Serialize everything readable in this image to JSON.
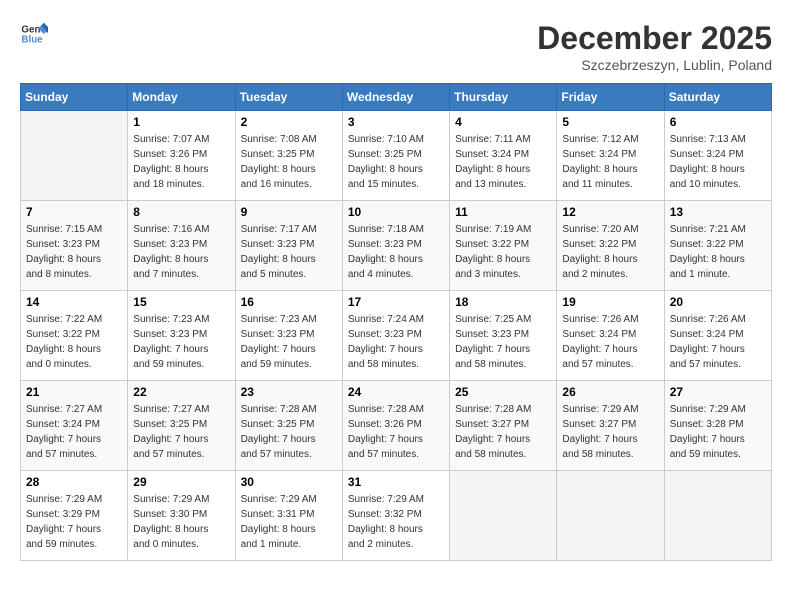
{
  "logo": {
    "text_general": "General",
    "text_blue": "Blue"
  },
  "title": "December 2025",
  "location": "Szczebrzeszyn, Lublin, Poland",
  "days_of_week": [
    "Sunday",
    "Monday",
    "Tuesday",
    "Wednesday",
    "Thursday",
    "Friday",
    "Saturday"
  ],
  "weeks": [
    [
      {
        "day": "",
        "info": ""
      },
      {
        "day": "1",
        "info": "Sunrise: 7:07 AM\nSunset: 3:26 PM\nDaylight: 8 hours\nand 18 minutes."
      },
      {
        "day": "2",
        "info": "Sunrise: 7:08 AM\nSunset: 3:25 PM\nDaylight: 8 hours\nand 16 minutes."
      },
      {
        "day": "3",
        "info": "Sunrise: 7:10 AM\nSunset: 3:25 PM\nDaylight: 8 hours\nand 15 minutes."
      },
      {
        "day": "4",
        "info": "Sunrise: 7:11 AM\nSunset: 3:24 PM\nDaylight: 8 hours\nand 13 minutes."
      },
      {
        "day": "5",
        "info": "Sunrise: 7:12 AM\nSunset: 3:24 PM\nDaylight: 8 hours\nand 11 minutes."
      },
      {
        "day": "6",
        "info": "Sunrise: 7:13 AM\nSunset: 3:24 PM\nDaylight: 8 hours\nand 10 minutes."
      }
    ],
    [
      {
        "day": "7",
        "info": "Sunrise: 7:15 AM\nSunset: 3:23 PM\nDaylight: 8 hours\nand 8 minutes."
      },
      {
        "day": "8",
        "info": "Sunrise: 7:16 AM\nSunset: 3:23 PM\nDaylight: 8 hours\nand 7 minutes."
      },
      {
        "day": "9",
        "info": "Sunrise: 7:17 AM\nSunset: 3:23 PM\nDaylight: 8 hours\nand 5 minutes."
      },
      {
        "day": "10",
        "info": "Sunrise: 7:18 AM\nSunset: 3:23 PM\nDaylight: 8 hours\nand 4 minutes."
      },
      {
        "day": "11",
        "info": "Sunrise: 7:19 AM\nSunset: 3:22 PM\nDaylight: 8 hours\nand 3 minutes."
      },
      {
        "day": "12",
        "info": "Sunrise: 7:20 AM\nSunset: 3:22 PM\nDaylight: 8 hours\nand 2 minutes."
      },
      {
        "day": "13",
        "info": "Sunrise: 7:21 AM\nSunset: 3:22 PM\nDaylight: 8 hours\nand 1 minute."
      }
    ],
    [
      {
        "day": "14",
        "info": "Sunrise: 7:22 AM\nSunset: 3:22 PM\nDaylight: 8 hours\nand 0 minutes."
      },
      {
        "day": "15",
        "info": "Sunrise: 7:23 AM\nSunset: 3:23 PM\nDaylight: 7 hours\nand 59 minutes."
      },
      {
        "day": "16",
        "info": "Sunrise: 7:23 AM\nSunset: 3:23 PM\nDaylight: 7 hours\nand 59 minutes."
      },
      {
        "day": "17",
        "info": "Sunrise: 7:24 AM\nSunset: 3:23 PM\nDaylight: 7 hours\nand 58 minutes."
      },
      {
        "day": "18",
        "info": "Sunrise: 7:25 AM\nSunset: 3:23 PM\nDaylight: 7 hours\nand 58 minutes."
      },
      {
        "day": "19",
        "info": "Sunrise: 7:26 AM\nSunset: 3:24 PM\nDaylight: 7 hours\nand 57 minutes."
      },
      {
        "day": "20",
        "info": "Sunrise: 7:26 AM\nSunset: 3:24 PM\nDaylight: 7 hours\nand 57 minutes."
      }
    ],
    [
      {
        "day": "21",
        "info": "Sunrise: 7:27 AM\nSunset: 3:24 PM\nDaylight: 7 hours\nand 57 minutes."
      },
      {
        "day": "22",
        "info": "Sunrise: 7:27 AM\nSunset: 3:25 PM\nDaylight: 7 hours\nand 57 minutes."
      },
      {
        "day": "23",
        "info": "Sunrise: 7:28 AM\nSunset: 3:25 PM\nDaylight: 7 hours\nand 57 minutes."
      },
      {
        "day": "24",
        "info": "Sunrise: 7:28 AM\nSunset: 3:26 PM\nDaylight: 7 hours\nand 57 minutes."
      },
      {
        "day": "25",
        "info": "Sunrise: 7:28 AM\nSunset: 3:27 PM\nDaylight: 7 hours\nand 58 minutes."
      },
      {
        "day": "26",
        "info": "Sunrise: 7:29 AM\nSunset: 3:27 PM\nDaylight: 7 hours\nand 58 minutes."
      },
      {
        "day": "27",
        "info": "Sunrise: 7:29 AM\nSunset: 3:28 PM\nDaylight: 7 hours\nand 59 minutes."
      }
    ],
    [
      {
        "day": "28",
        "info": "Sunrise: 7:29 AM\nSunset: 3:29 PM\nDaylight: 7 hours\nand 59 minutes."
      },
      {
        "day": "29",
        "info": "Sunrise: 7:29 AM\nSunset: 3:30 PM\nDaylight: 8 hours\nand 0 minutes."
      },
      {
        "day": "30",
        "info": "Sunrise: 7:29 AM\nSunset: 3:31 PM\nDaylight: 8 hours\nand 1 minute."
      },
      {
        "day": "31",
        "info": "Sunrise: 7:29 AM\nSunset: 3:32 PM\nDaylight: 8 hours\nand 2 minutes."
      },
      {
        "day": "",
        "info": ""
      },
      {
        "day": "",
        "info": ""
      },
      {
        "day": "",
        "info": ""
      }
    ]
  ]
}
